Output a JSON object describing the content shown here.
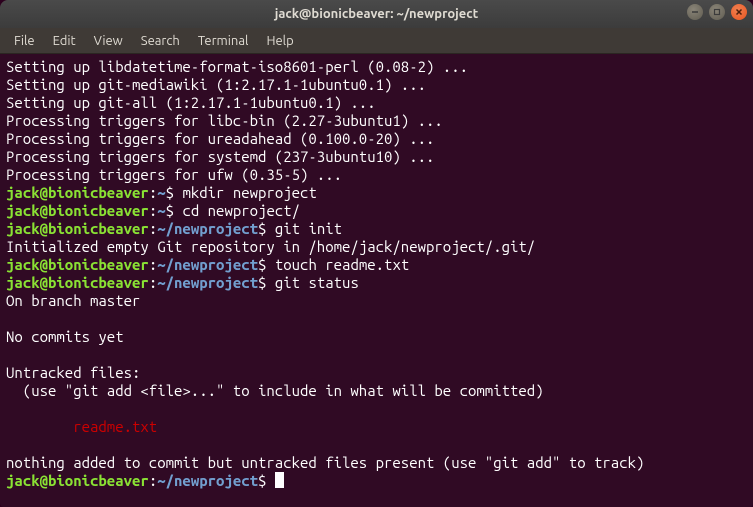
{
  "window": {
    "title": "jack@bionicbeaver: ~/newproject"
  },
  "menubar": {
    "items": [
      "File",
      "Edit",
      "View",
      "Search",
      "Terminal",
      "Help"
    ]
  },
  "prompt": {
    "user_host": "jack@bionicbeaver",
    "sep": ":",
    "home": "~",
    "path_project": "~/newproject",
    "dollar": "$ "
  },
  "output": {
    "l1": "Setting up libdatetime-format-iso8601-perl (0.08-2) ...",
    "l2": "Setting up git-mediawiki (1:2.17.1-1ubuntu0.1) ...",
    "l3": "Setting up git-all (1:2.17.1-1ubuntu0.1) ...",
    "l4": "Processing triggers for libc-bin (2.27-3ubuntu1) ...",
    "l5": "Processing triggers for ureadahead (0.100.0-20) ...",
    "l6": "Processing triggers for systemd (237-3ubuntu10) ...",
    "l7": "Processing triggers for ufw (0.35-5) ...",
    "cmd1": "mkdir newproject",
    "cmd2": "cd newproject/",
    "cmd3": "git init",
    "init_msg": "Initialized empty Git repository in /home/jack/newproject/.git/",
    "cmd4": "touch readme.txt",
    "cmd5": "git status",
    "branch": "On branch master",
    "nocommits": "No commits yet",
    "untracked_header": "Untracked files:",
    "untracked_hint": "  (use \"git add <file>...\" to include in what will be committed)",
    "untracked_file": "        readme.txt",
    "nothing_added": "nothing added to commit but untracked files present (use \"git add\" to track)"
  }
}
